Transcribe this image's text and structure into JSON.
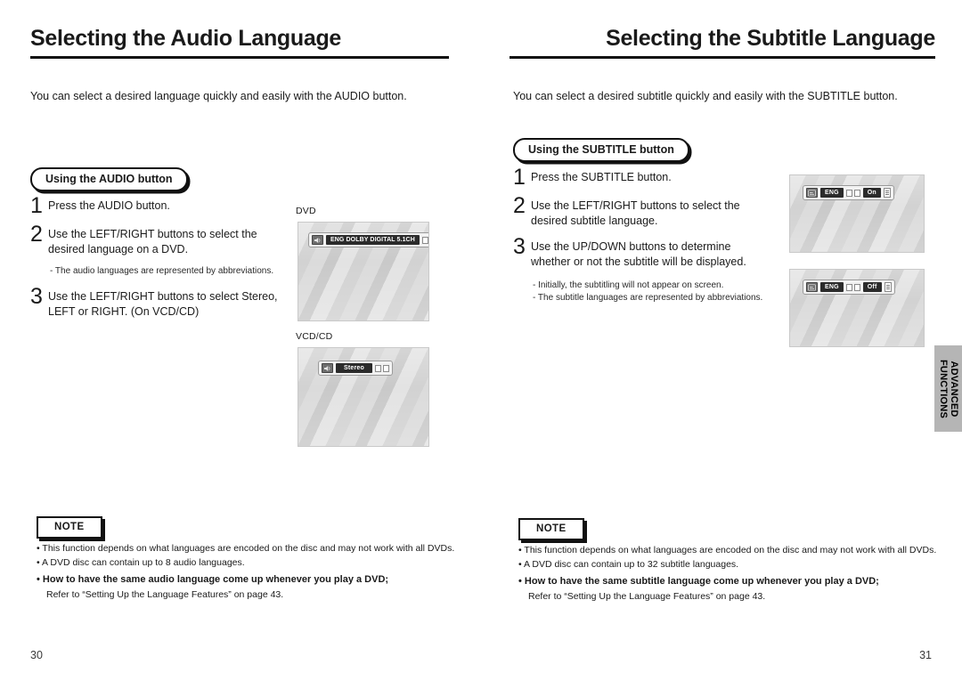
{
  "left_page": {
    "title": "Selecting the Audio Language",
    "intro": "You can select a desired language quickly and easily with the AUDIO button.",
    "pill": "Using the AUDIO button",
    "steps": [
      {
        "num": "1",
        "line1": "Press the AUDIO button.",
        "line2": ""
      },
      {
        "num": "2",
        "line1": "Use the LEFT/RIGHT buttons to select the",
        "line2": "desired language on a DVD."
      },
      {
        "num": "3",
        "line1": "Use the LEFT/RIGHT buttons to select Stereo,",
        "line2": "LEFT or RIGHT. (On VCD/CD)"
      }
    ],
    "substep": "- The audio languages are represented by abbreviations.",
    "screens": [
      {
        "label": "DVD",
        "osd": {
          "icon": "audio-speaker-icon",
          "chip": "ENG  DOLBY DIGITAL  5.1CH",
          "squares": 2
        }
      },
      {
        "label": "VCD/CD",
        "osd": {
          "icon": "audio-speaker-icon",
          "chip": "Stereo",
          "squares": 2
        }
      }
    ],
    "note": {
      "heading": "NOTE",
      "items": [
        "• This function depends on what languages are encoded on the disc and may not work with all DVDs.",
        "• A DVD disc can contain up to 8 audio languages."
      ],
      "bold_item": "• How to have the same audio language come up whenever you play  a DVD;",
      "sub_item": "Refer to “Setting Up the Language Features” on page 43."
    },
    "page_number": "30"
  },
  "right_page": {
    "title": "Selecting the Subtitle Language",
    "intro": "You can select a desired subtitle quickly and easily with the SUBTITLE button.",
    "pill": "Using the SUBTITLE button",
    "steps": [
      {
        "num": "1",
        "line1": "Press the SUBTITLE button.",
        "line2": ""
      },
      {
        "num": "2",
        "line1": "Use the LEFT/RIGHT buttons to select the",
        "line2": "desired subtitle language."
      },
      {
        "num": "3",
        "line1": "Use the UP/DOWN buttons to determine",
        "line2": "whether or not the subtitle will be displayed."
      }
    ],
    "substeps": [
      "- Initially, the subtitling will not appear on screen.",
      "- The subtitle languages are represented by abbreviations."
    ],
    "screens": [
      {
        "label": "",
        "osd": {
          "icon": "subtitle-icon",
          "chip": "ENG",
          "chip2": "On",
          "squares": 2
        }
      },
      {
        "label": "",
        "osd": {
          "icon": "subtitle-icon",
          "chip": "ENG",
          "chip2": "Off",
          "squares": 2
        }
      }
    ],
    "note": {
      "heading": "NOTE",
      "items": [
        "• This function depends on what languages are encoded on the disc and may not work with all DVDs.",
        "• A DVD disc can contain up to 32 subtitle languages."
      ],
      "bold_item": "• How to have the same subtitle language come up whenever you play  a DVD;",
      "sub_item": "Refer to “Setting Up the Language Features” on page 43."
    },
    "page_number": "31"
  },
  "side_tab": {
    "line1": "ADVANCED",
    "line2": "FUNCTIONS",
    "background": "#b5b5b5"
  }
}
